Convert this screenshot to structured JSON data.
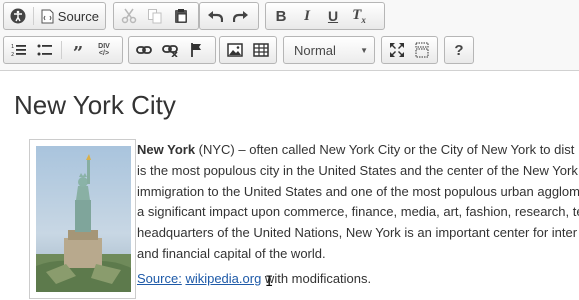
{
  "toolbar": {
    "source_label": "Source",
    "format_value": "Normal"
  },
  "document": {
    "title": "New York City",
    "paragraph_lines": [
      {
        "bold": "New York",
        "rest": " (NYC) – often called New York City or the City of New York to dist"
      },
      {
        "bold": "",
        "rest": "is the most populous city in the United States and the center of the New York"
      },
      {
        "bold": "",
        "rest": "immigration to the United States and one of the most populous urban agglom"
      },
      {
        "bold": "",
        "rest": "a significant impact upon commerce, finance, media, art, fashion, research, te"
      },
      {
        "bold": "",
        "rest": "headquarters of the United Nations, New York is an important center for inter"
      },
      {
        "bold": "",
        "rest": "and financial capital of the world."
      }
    ],
    "source_label": "Source:",
    "source_link": "wikipedia.org",
    "source_suffix": " with modifications."
  },
  "icons": {
    "row1": [
      "accessibility-icon",
      "source-icon",
      "cut-icon",
      "copy-icon",
      "paste-icon",
      "undo-icon",
      "redo-icon",
      "bold-icon",
      "italic-icon",
      "underline-icon",
      "remove-format-icon"
    ],
    "row2": [
      "numbered-list-icon",
      "bulleted-list-icon",
      "blockquote-icon",
      "div-icon",
      "link-icon",
      "unlink-icon",
      "anchor-icon",
      "image-icon",
      "table-icon",
      "maximize-icon",
      "show-blocks-icon",
      "help-icon"
    ]
  }
}
